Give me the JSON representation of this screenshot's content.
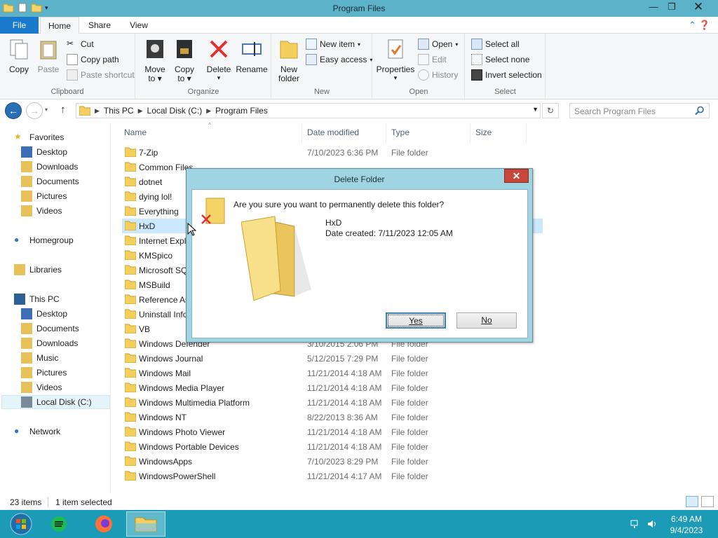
{
  "window": {
    "title": "Program Files"
  },
  "ribbon_tabs": [
    "File",
    "Home",
    "Share",
    "View"
  ],
  "ribbon": {
    "clipboard": {
      "label": "Clipboard",
      "copy": "Copy",
      "paste": "Paste",
      "cut": "Cut",
      "copy_path": "Copy path",
      "paste_shortcut": "Paste shortcut"
    },
    "organize": {
      "label": "Organize",
      "move_to": "Move",
      "move_to2": "to",
      "copy_to": "Copy",
      "copy_to2": "to",
      "delete": "Delete",
      "rename": "Rename"
    },
    "new": {
      "label": "New",
      "new_folder": "New",
      "new_folder2": "folder",
      "new_item": "New item",
      "easy_access": "Easy access"
    },
    "open": {
      "label": "Open",
      "properties": "Properties",
      "open": "Open",
      "edit": "Edit",
      "history": "History"
    },
    "select": {
      "label": "Select",
      "select_all": "Select all",
      "select_none": "Select none",
      "invert": "Invert selection"
    }
  },
  "address": {
    "crumbs": [
      "This PC",
      "Local Disk (C:)",
      "Program Files"
    ],
    "search_placeholder": "Search Program Files"
  },
  "navpane": {
    "favorites": "Favorites",
    "fav_items": [
      "Desktop",
      "Downloads",
      "Documents",
      "Pictures",
      "Videos"
    ],
    "homegroup": "Homegroup",
    "libraries": "Libraries",
    "thispc": "This PC",
    "pc_items": [
      "Desktop",
      "Documents",
      "Downloads",
      "Music",
      "Pictures",
      "Videos",
      "Local Disk (C:)"
    ],
    "network": "Network"
  },
  "columns": {
    "name": "Name",
    "date": "Date modified",
    "type": "Type",
    "size": "Size"
  },
  "files": [
    {
      "name": "7-Zip",
      "date": "7/10/2023 6:36 PM",
      "type": "File folder"
    },
    {
      "name": "Common Files",
      "date": "",
      "type": ""
    },
    {
      "name": "dotnet",
      "date": "",
      "type": ""
    },
    {
      "name": "dying lol!",
      "date": "",
      "type": ""
    },
    {
      "name": "Everything",
      "date": "",
      "type": ""
    },
    {
      "name": "HxD",
      "date": "",
      "type": ""
    },
    {
      "name": "Internet Explo",
      "date": "",
      "type": ""
    },
    {
      "name": "KMSpico",
      "date": "",
      "type": ""
    },
    {
      "name": "Microsoft SQ",
      "date": "",
      "type": ""
    },
    {
      "name": "MSBuild",
      "date": "",
      "type": ""
    },
    {
      "name": "Reference As",
      "date": "",
      "type": ""
    },
    {
      "name": "Uninstall Infor",
      "date": "",
      "type": ""
    },
    {
      "name": "VB",
      "date": "",
      "type": ""
    },
    {
      "name": "Windows Defender",
      "date": "3/10/2015 2:06 PM",
      "type": "File folder"
    },
    {
      "name": "Windows Journal",
      "date": "5/12/2015 7:29 PM",
      "type": "File folder"
    },
    {
      "name": "Windows Mail",
      "date": "11/21/2014 4:18 AM",
      "type": "File folder"
    },
    {
      "name": "Windows Media Player",
      "date": "11/21/2014 4:18 AM",
      "type": "File folder"
    },
    {
      "name": "Windows Multimedia Platform",
      "date": "11/21/2014 4:18 AM",
      "type": "File folder"
    },
    {
      "name": "Windows NT",
      "date": "8/22/2013 8:36 AM",
      "type": "File folder"
    },
    {
      "name": "Windows Photo Viewer",
      "date": "11/21/2014 4:18 AM",
      "type": "File folder"
    },
    {
      "name": "Windows Portable Devices",
      "date": "11/21/2014 4:18 AM",
      "type": "File folder"
    },
    {
      "name": "WindowsApps",
      "date": "7/10/2023 8:29 PM",
      "type": "File folder"
    },
    {
      "name": "WindowsPowerShell",
      "date": "11/21/2014 4:17 AM",
      "type": "File folder"
    }
  ],
  "status": {
    "count": "23 items",
    "selected": "1 item selected"
  },
  "dialog": {
    "title": "Delete Folder",
    "question": "Are you sure you want to permanently delete this folder?",
    "folder_name": "HxD",
    "date_created": "Date created: 7/11/2023 12:05 AM",
    "yes": "Yes",
    "no": "No"
  },
  "taskbar": {
    "time": "6:49 AM",
    "date": "9/4/2023"
  }
}
